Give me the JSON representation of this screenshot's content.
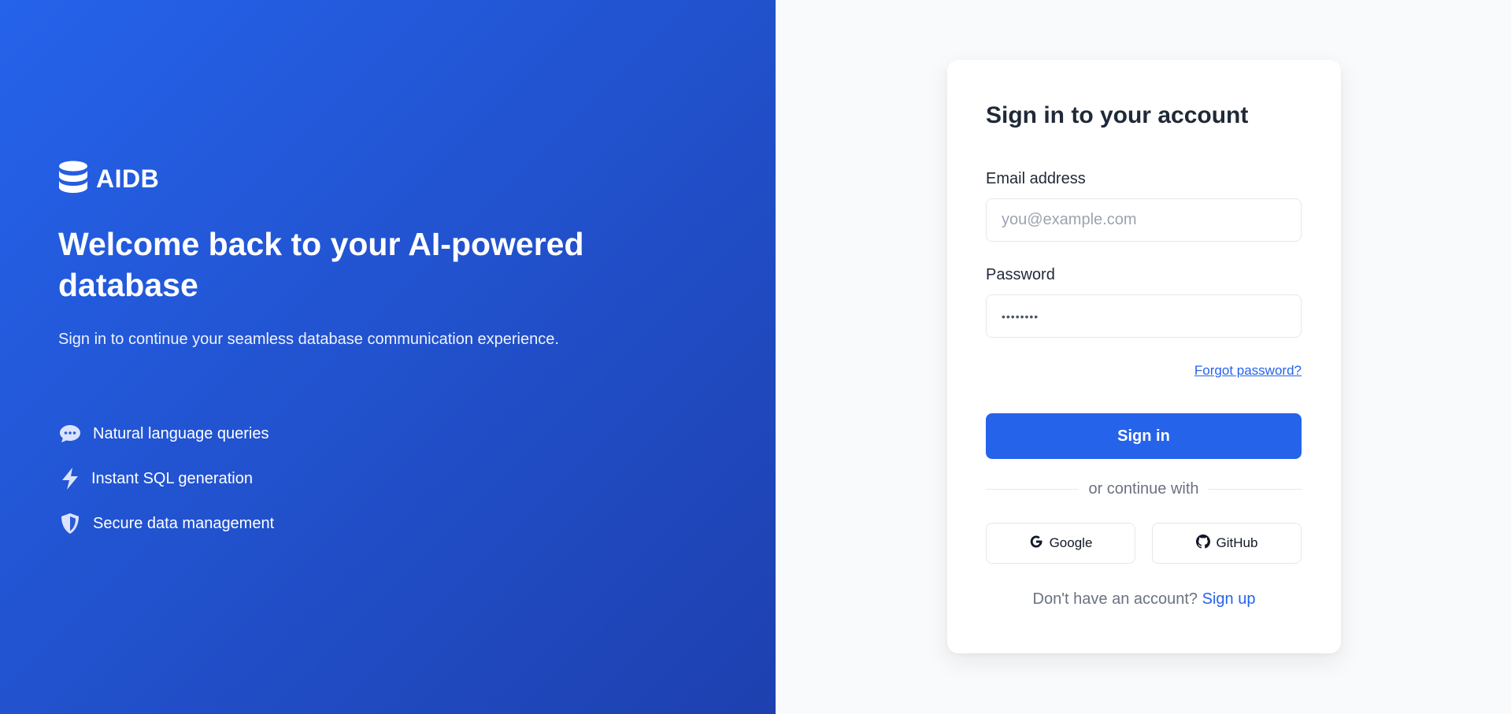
{
  "brand": {
    "name": "AIDB",
    "icon": "database-icon"
  },
  "hero": {
    "title": "Welcome back to your AI-powered database",
    "subtitle": "Sign in to continue your seamless database communication experience.",
    "features": [
      {
        "icon": "chat-bubble-icon",
        "label": "Natural language queries"
      },
      {
        "icon": "lightning-icon",
        "label": "Instant SQL generation"
      },
      {
        "icon": "shield-icon",
        "label": "Secure data management"
      }
    ]
  },
  "form": {
    "title": "Sign in to your account",
    "email_label": "Email address",
    "email_placeholder": "you@example.com",
    "email_value": "",
    "password_label": "Password",
    "password_value": "••••••••",
    "forgot_label": "Forgot password?",
    "submit_label": "Sign in",
    "divider_label": "or continue with",
    "google_label": "Google",
    "github_label": "GitHub",
    "signup_prompt": "Don't have an account?",
    "signup_link": "Sign up"
  },
  "colors": {
    "primary": "#2563eb",
    "hero_gradient_start": "#2563eb",
    "hero_gradient_end": "#1e40af",
    "background": "#f9fafb"
  }
}
